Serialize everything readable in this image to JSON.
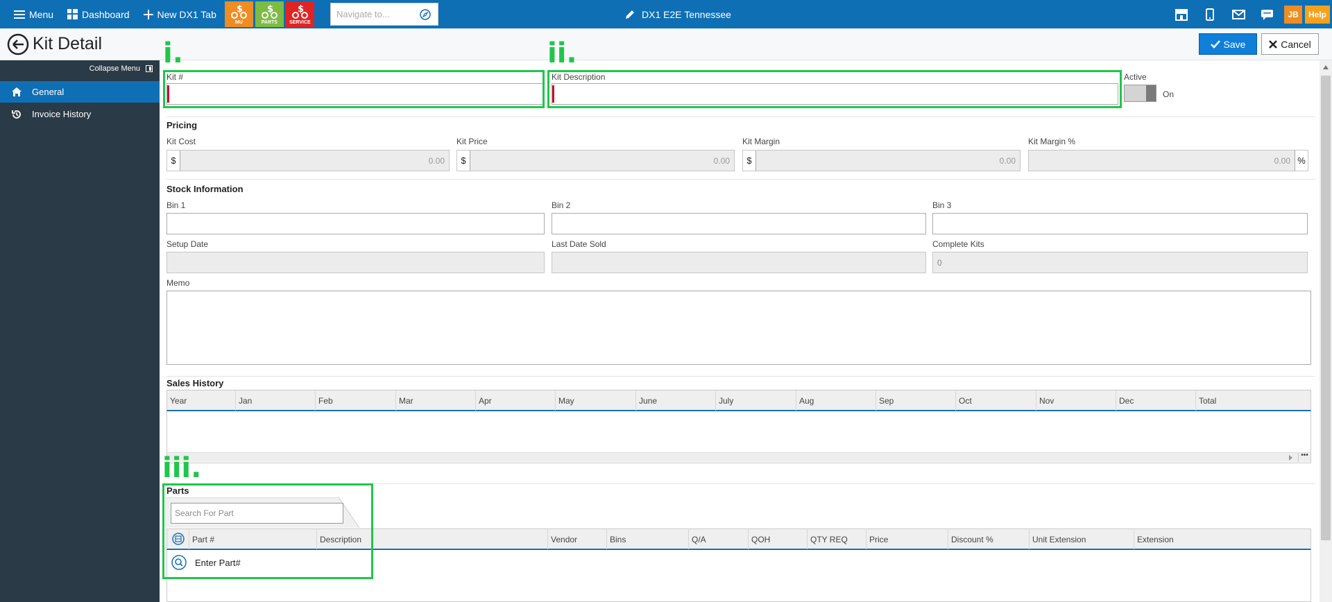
{
  "topbar": {
    "menu_label": "Menu",
    "dashboard_label": "Dashboard",
    "new_tab_label": "New DX1 Tab",
    "tiles": [
      {
        "label": "MU",
        "color": "#ef8c22"
      },
      {
        "label": "PARTS",
        "color": "#7dbb42"
      },
      {
        "label": "SERVICE",
        "color": "#e02424"
      }
    ],
    "navigate_placeholder": "Navigate to...",
    "store_name": "DX1 E2E Tennessee",
    "user_initials": "JB",
    "help_label": "Help"
  },
  "titlebar": {
    "title": "Kit Detail",
    "save_label": "Save",
    "cancel_label": "Cancel"
  },
  "sidebar": {
    "collapse_label": "Collapse Menu",
    "items": [
      {
        "label": "General",
        "icon": "home-icon",
        "active": true
      },
      {
        "label": "Invoice History",
        "icon": "history-icon",
        "active": false
      }
    ]
  },
  "form": {
    "kit_number_label": "Kit #",
    "kit_description_label": "Kit Description",
    "active_label": "Active",
    "active_state": "On",
    "pricing": {
      "title": "Pricing",
      "currency": "$",
      "percent": "%",
      "kit_cost_label": "Kit Cost",
      "kit_cost": "0.00",
      "kit_price_label": "Kit Price",
      "kit_price": "0.00",
      "kit_margin_label": "Kit Margin",
      "kit_margin": "0.00",
      "kit_margin_pct_label": "Kit Margin %",
      "kit_margin_pct": "0.00"
    },
    "stock": {
      "title": "Stock Information",
      "bin1_label": "Bin 1",
      "bin2_label": "Bin 2",
      "bin3_label": "Bin 3",
      "setup_date_label": "Setup Date",
      "last_date_sold_label": "Last Date Sold",
      "complete_kits_label": "Complete Kits",
      "complete_kits": "0",
      "memo_label": "Memo"
    }
  },
  "sales_history": {
    "title": "Sales History",
    "columns": [
      "Year",
      "Jan",
      "Feb",
      "Mar",
      "Apr",
      "May",
      "June",
      "July",
      "Aug",
      "Sep",
      "Oct",
      "Nov",
      "Dec",
      "Total"
    ]
  },
  "parts": {
    "title": "Parts",
    "search_placeholder": "Search For Part",
    "columns": [
      "Part #",
      "Description",
      "Vendor",
      "Bins",
      "Q/A",
      "QOH",
      "QTY REQ",
      "Price",
      "Discount %",
      "Unit Extension",
      "Extension"
    ],
    "enter_part_label": "Enter Part#"
  },
  "annotations": [
    "i.",
    "ii.",
    "iii."
  ],
  "highlight_color": "#1fc64b"
}
